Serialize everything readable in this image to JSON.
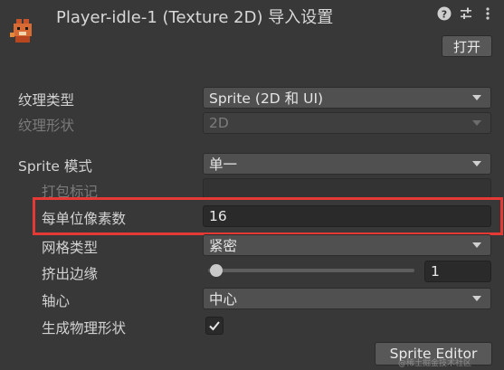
{
  "header": {
    "title": "Player-idle-1 (Texture 2D) 导入设置",
    "open_button": "打开",
    "icons": [
      "help-icon",
      "settings-sliders-icon",
      "more-vertical-icon"
    ]
  },
  "fields": {
    "texture_type": {
      "label": "纹理类型",
      "value": "Sprite (2D 和 UI)"
    },
    "texture_shape": {
      "label": "纹理形状",
      "value": "2D"
    },
    "sprite_mode": {
      "label": "Sprite 模式",
      "value": "单一"
    },
    "packing_tag": {
      "label": "打包标记",
      "value": ""
    },
    "pixels_per_unit": {
      "label": "每单位像素数",
      "value": "16"
    },
    "mesh_type": {
      "label": "网格类型",
      "value": "紧密"
    },
    "extrude_edges": {
      "label": "挤出边缘",
      "value": "1",
      "slider_fraction": 0.03
    },
    "pivot": {
      "label": "轴心",
      "value": "中心"
    },
    "generate_physics_shape": {
      "label": "生成物理形状",
      "checked": true
    }
  },
  "sprite_editor_button": "Sprite Editor",
  "watermark": "@稀土掘金技术社区",
  "colors": {
    "background": "#383838",
    "highlight": "#e53935",
    "field_bg": "#2a2a2a",
    "dropdown_bg": "#505050"
  }
}
